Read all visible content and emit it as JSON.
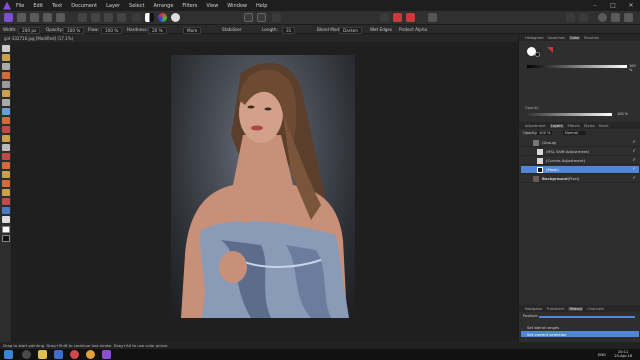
{
  "menu": {
    "items": [
      "File",
      "Edit",
      "Text",
      "Document",
      "Layer",
      "Select",
      "Arrange",
      "Filters",
      "View",
      "Window",
      "Help"
    ],
    "window_controls": [
      "–",
      "□",
      "✕"
    ]
  },
  "context": {
    "width_label": "Width:",
    "width_value": "200 px",
    "opacity_label": "Opacity:",
    "opacity_value": "100 %",
    "flow_label": "Flow:",
    "flow_value": "100 %",
    "hardness_label": "Hardness:",
    "hardness_value": "20 %",
    "more_button": "More",
    "stabilizer_label": "Stabilizer",
    "length_label": "Length:",
    "length_value": "31",
    "blend_label": "Blend Mode:",
    "blend_value": "Darken",
    "wet_edges_label": "Wet Edges",
    "protect_alpha_label": "Protect Alpha"
  },
  "document": {
    "tab_title": "girl-332716.jpg [Modified] (17.1%)"
  },
  "panels": {
    "color_tabs": [
      "Histogram",
      "Swatches",
      "Color",
      "Brushes"
    ],
    "color_active": "Color",
    "opacity_label": "Opacity",
    "opacity_value": "100 %",
    "slider_value": "100 %",
    "layer_tabs": [
      "Adjustment",
      "Layers",
      "Effects",
      "Styles",
      "Stock"
    ],
    "layers_active": "Layers",
    "layers_opacity_label": "Opacity:",
    "layers_opacity_value": "100 %",
    "layers_blend_value": "Normal",
    "layers": [
      {
        "name": "(Group)",
        "selected": false
      },
      {
        "name": "(HSL Shift Adjustment)",
        "selected": false
      },
      {
        "name": "(Curves Adjustment)",
        "selected": false
      },
      {
        "name": "(Mask)",
        "selected": true
      },
      {
        "name": "Background",
        "suffix": " (Pixel)",
        "selected": false
      }
    ],
    "history_tabs": [
      "Navigator",
      "Transform",
      "History",
      "Channels"
    ],
    "history_active": "History",
    "position_label": "Position:",
    "history": [
      {
        "name": "Set blend ranges",
        "selected": false
      },
      {
        "name": "Set current selection",
        "selected": true
      }
    ]
  },
  "status": {
    "text": "Drag to start painting. Drag+Shift to continue last stroke. Drag+Alt to use color picker."
  },
  "taskbar": {
    "language": "ENG",
    "time": "20:11",
    "date": "25-Apr-18"
  },
  "colors": {
    "accent": "#4f86d6",
    "brand": "#8a4fd6",
    "background": "#2b2b2b",
    "canvas": "#1f1f1f"
  }
}
